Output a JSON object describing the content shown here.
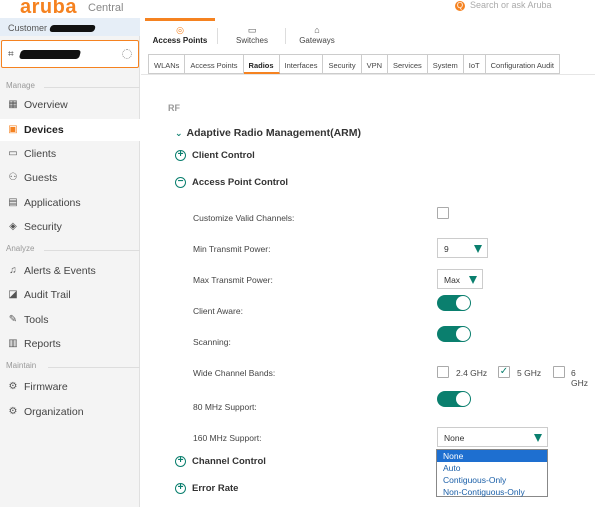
{
  "header": {
    "logo": "aruba",
    "logo_sub": "Central",
    "search_placeholder": "Search or ask Aruba"
  },
  "sidebar": {
    "customer_label": "Customer",
    "sections": [
      {
        "label": "Manage",
        "items": [
          {
            "label": "Overview",
            "icon": "grid-icon"
          },
          {
            "label": "Devices",
            "icon": "device-icon",
            "active": true
          },
          {
            "label": "Clients",
            "icon": "monitor-icon"
          },
          {
            "label": "Guests",
            "icon": "users-icon"
          },
          {
            "label": "Applications",
            "icon": "app-icon"
          },
          {
            "label": "Security",
            "icon": "shield-icon"
          }
        ]
      },
      {
        "label": "Analyze",
        "items": [
          {
            "label": "Alerts & Events",
            "icon": "bell-icon"
          },
          {
            "label": "Audit Trail",
            "icon": "trail-icon"
          },
          {
            "label": "Tools",
            "icon": "wrench-icon"
          },
          {
            "label": "Reports",
            "icon": "report-icon"
          }
        ]
      },
      {
        "label": "Maintain",
        "items": [
          {
            "label": "Firmware",
            "icon": "firmware-icon"
          },
          {
            "label": "Organization",
            "icon": "org-icon"
          }
        ]
      }
    ]
  },
  "device_tabs": [
    {
      "label": "Access Points",
      "icon": "ap-icon",
      "active": true
    },
    {
      "label": "Switches",
      "icon": "switch-icon"
    },
    {
      "label": "Gateways",
      "icon": "gateway-icon"
    }
  ],
  "sub_tabs": [
    "WLANs",
    "Access Points",
    "Radios",
    "Interfaces",
    "Security",
    "VPN",
    "Services",
    "System",
    "IoT",
    "Configuration Audit"
  ],
  "sub_tab_active": "Radios",
  "main": {
    "rf_label": "RF",
    "arm_title": "Adaptive Radio Management(ARM)",
    "client_control": "Client Control",
    "ap_control": "Access Point Control",
    "fields": {
      "custom_channels": "Customize Valid Channels:",
      "min_power": "Min Transmit Power:",
      "min_power_value": "9",
      "max_power": "Max Transmit Power:",
      "max_power_value": "Max",
      "client_aware": "Client Aware:",
      "scanning": "Scanning:",
      "wide_bands": "Wide Channel Bands:",
      "band_24": "2.4 GHz",
      "band_5": "5 GHz",
      "band_6": "6 GHz",
      "mhz80": "80 MHz Support:",
      "mhz160": "160 MHz Support:",
      "mhz160_value": "None"
    },
    "dropdown_options": [
      "None",
      "Auto",
      "Contiguous-Only",
      "Non-Contiguous-Only"
    ],
    "channel_control": "Channel Control",
    "error_rate": "Error Rate"
  },
  "colors": {
    "brand": "#f58220",
    "accent": "#0a7f6e",
    "selected": "#1e6fd0"
  }
}
